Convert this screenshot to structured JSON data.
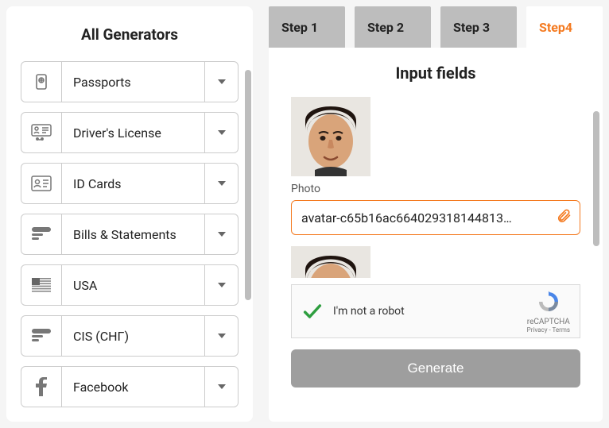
{
  "sidebar": {
    "title": "All Generators",
    "items": [
      {
        "label": "Passports"
      },
      {
        "label": "Driver's License"
      },
      {
        "label": "ID Cards"
      },
      {
        "label": "Bills & Statements"
      },
      {
        "label": "USA"
      },
      {
        "label": "CIS (СНГ)"
      },
      {
        "label": "Facebook"
      }
    ]
  },
  "steps": [
    {
      "label": "Step 1"
    },
    {
      "label": "Step 2"
    },
    {
      "label": "Step 3"
    },
    {
      "label": "Step4",
      "active": true
    }
  ],
  "panel": {
    "title": "Input fields",
    "photo_label": "Photo",
    "photo_value": "avatar-c65b16ac664029318144813…"
  },
  "recaptcha": {
    "label": "I'm not a robot",
    "brand": "reCAPTCHA",
    "links": "Privacy - Terms"
  },
  "generate_label": "Generate"
}
